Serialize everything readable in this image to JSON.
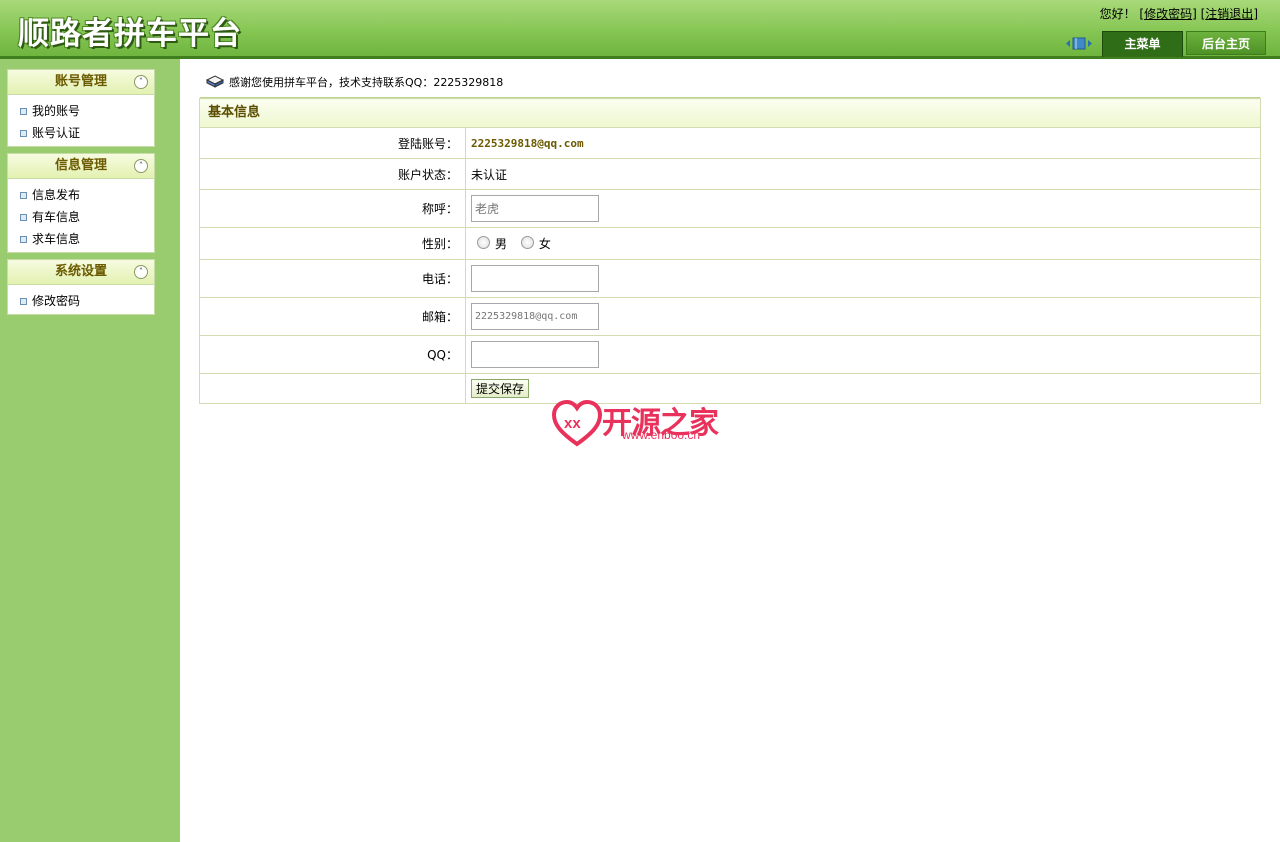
{
  "header": {
    "logo": "顺路者拼车平台",
    "greeting": "您好！",
    "change_password_link": "修改密码",
    "logout_link": "注销退出",
    "tabs": [
      {
        "label": "主菜单"
      },
      {
        "label": "后台主页"
      }
    ]
  },
  "sidebar": {
    "panels": [
      {
        "title": "账号管理",
        "items": [
          "我的账号",
          "账号认证"
        ]
      },
      {
        "title": "信息管理",
        "items": [
          "信息发布",
          "有车信息",
          "求车信息"
        ]
      },
      {
        "title": "系统设置",
        "items": [
          "修改密码"
        ]
      }
    ]
  },
  "main": {
    "notice": "感谢您使用拼车平台，技术支持联系QQ：2225329818",
    "section_title": "基本信息",
    "fields": {
      "login_account": {
        "label": "登陆账号：",
        "value": "2225329818@qq.com"
      },
      "account_status": {
        "label": "账户状态：",
        "value": "未认证"
      },
      "nickname": {
        "label": "称呼：",
        "placeholder": "老虎"
      },
      "gender": {
        "label": "性别：",
        "options": [
          "男",
          "女"
        ]
      },
      "phone": {
        "label": "电话：",
        "value": ""
      },
      "email": {
        "label": "邮箱：",
        "placeholder": "2225329818@qq.com"
      },
      "qq": {
        "label": "QQ：",
        "value": ""
      }
    },
    "submit_label": "提交保存"
  },
  "watermark": {
    "title": "开源之家",
    "url": "www.enboo.cn"
  },
  "colors": {
    "header_green": "#86c654",
    "sidebar_green": "#99cc6e",
    "panel_title": "#6b5a00",
    "dark_tab": "#2f6e17"
  }
}
